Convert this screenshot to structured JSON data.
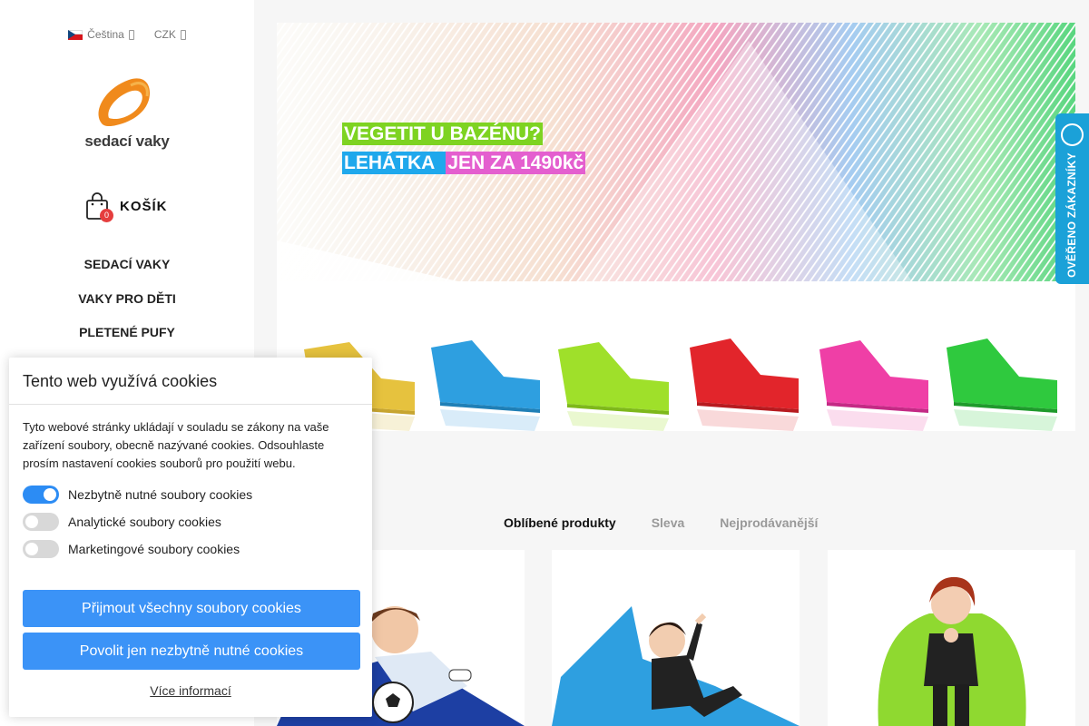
{
  "topbar": {
    "language": "Čeština",
    "currency": "CZK"
  },
  "brand": {
    "name": "sedací vaky"
  },
  "cart": {
    "count": "0",
    "label": "KOŠÍK"
  },
  "menu": [
    {
      "label": "SEDACÍ VAKY"
    },
    {
      "label": "VAKY PRO DĚTI"
    },
    {
      "label": "PLETENÉ PUFY"
    }
  ],
  "banner": {
    "line1": "VEGETIT U BAZÉNU?",
    "line2a": "LEHÁTKA",
    "line2b": "JEN ZA 1490kč",
    "lounger_colors": [
      "#e6c23e",
      "#2e9fe0",
      "#9fe02a",
      "#e2252b",
      "#ef3fa6",
      "#2fc93e"
    ]
  },
  "verified": {
    "label": "OVĚŘENO ZÁKAZNÍKY"
  },
  "tabs": [
    {
      "label": "Oblíbené produkty",
      "active": true
    },
    {
      "label": "Sleva",
      "active": false
    },
    {
      "label": "Nejprodávanější",
      "active": false
    }
  ],
  "cookie": {
    "title": "Tento web využívá cookies",
    "text": "Tyto webové stránky ukládají v souladu se zákony na vaše zařízení soubory, obecně nazývané cookies. Odsouhlaste prosím nastavení cookies souborů pro použití webu.",
    "toggles": [
      {
        "label": "Nezbytně nutné soubory cookies",
        "on": true
      },
      {
        "label": "Analytické soubory cookies",
        "on": false
      },
      {
        "label": "Marketingové soubory cookies",
        "on": false
      }
    ],
    "accept_all": "Přijmout všechny soubory cookies",
    "accept_necessary": "Povolit jen nezbytně nutné cookies",
    "more": "Více informací"
  },
  "colors": {
    "accent_blue": "#3b93f7",
    "brand_orange": "#f08a1c",
    "verified_blue": "#1ba1d8"
  }
}
